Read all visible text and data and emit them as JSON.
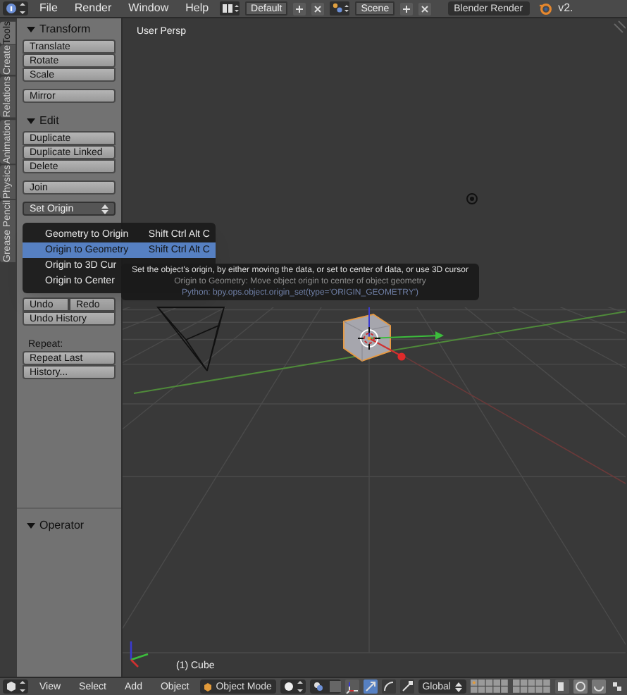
{
  "top_bar": {
    "menus": [
      "File",
      "Render",
      "Window",
      "Help"
    ],
    "layout_field": "Default",
    "scene_field": "Scene",
    "render_engine": "Blender Render",
    "version": "v2."
  },
  "tool_tabs": [
    {
      "label": "Tools",
      "selected": true
    },
    {
      "label": "Create",
      "selected": false
    },
    {
      "label": "Relations",
      "selected": false
    },
    {
      "label": "Animation",
      "selected": false
    },
    {
      "label": "Physics",
      "selected": false
    },
    {
      "label": "Grease Pencil",
      "selected": false
    }
  ],
  "tool_sections": [
    {
      "title": "Transform",
      "expanded": true,
      "groups": [
        [
          {
            "kind": "button",
            "label": "Translate"
          },
          {
            "kind": "button",
            "label": "Rotate"
          },
          {
            "kind": "button",
            "label": "Scale"
          }
        ],
        [
          {
            "kind": "button",
            "label": "Mirror"
          }
        ]
      ]
    },
    {
      "title": "Edit",
      "expanded": true,
      "groups": [
        [
          {
            "kind": "button",
            "label": "Duplicate"
          },
          {
            "kind": "button",
            "label": "Duplicate Linked"
          },
          {
            "kind": "button",
            "label": "Delete"
          }
        ],
        [
          {
            "kind": "button",
            "label": "Join"
          }
        ],
        [
          {
            "kind": "dropdown",
            "label": "Set Origin"
          }
        ]
      ]
    },
    {
      "groups": [
        [
          {
            "kind": "pair",
            "labels": [
              "Undo",
              "Redo"
            ]
          },
          {
            "kind": "button",
            "label": "Undo History"
          }
        ],
        [
          {
            "kind": "label",
            "label": "Repeat:"
          },
          {
            "kind": "button",
            "label": "Repeat Last"
          },
          {
            "kind": "button",
            "label": "History..."
          }
        ]
      ]
    }
  ],
  "operator_panel": {
    "title": "Operator",
    "expanded": true
  },
  "set_origin_menu": [
    {
      "label": "Geometry to Origin",
      "shortcut": "Shift Ctrl Alt C",
      "selected": false
    },
    {
      "label": "Origin to Geometry",
      "shortcut": "Shift Ctrl Alt C",
      "selected": true
    },
    {
      "label": "Origin to 3D Cur",
      "selected": false
    },
    {
      "label": "Origin to Center",
      "selected": false
    }
  ],
  "tooltip": [
    {
      "kind": "description",
      "text": "Set the object's origin, by either moving the data, or set to center of data, or use 3D cursor"
    },
    {
      "kind": "operator",
      "text": "Origin to Geometry: Move object origin to center of object geometry"
    },
    {
      "kind": "python",
      "text": "Python: bpy.ops.object.origin_set(type='ORIGIN_GEOMETRY')"
    }
  ],
  "viewport": {
    "view_label": "User Persp",
    "object_label": "(1) Cube"
  },
  "bottom_bar": {
    "menus": [
      "View",
      "Select",
      "Add",
      "Object"
    ],
    "mode": "Object Mode",
    "manipulator": {
      "on": true
    },
    "transform_modes": [
      {
        "selected": true
      },
      {
        "selected": false
      },
      {
        "selected": false
      }
    ],
    "orientation": "Global"
  }
}
